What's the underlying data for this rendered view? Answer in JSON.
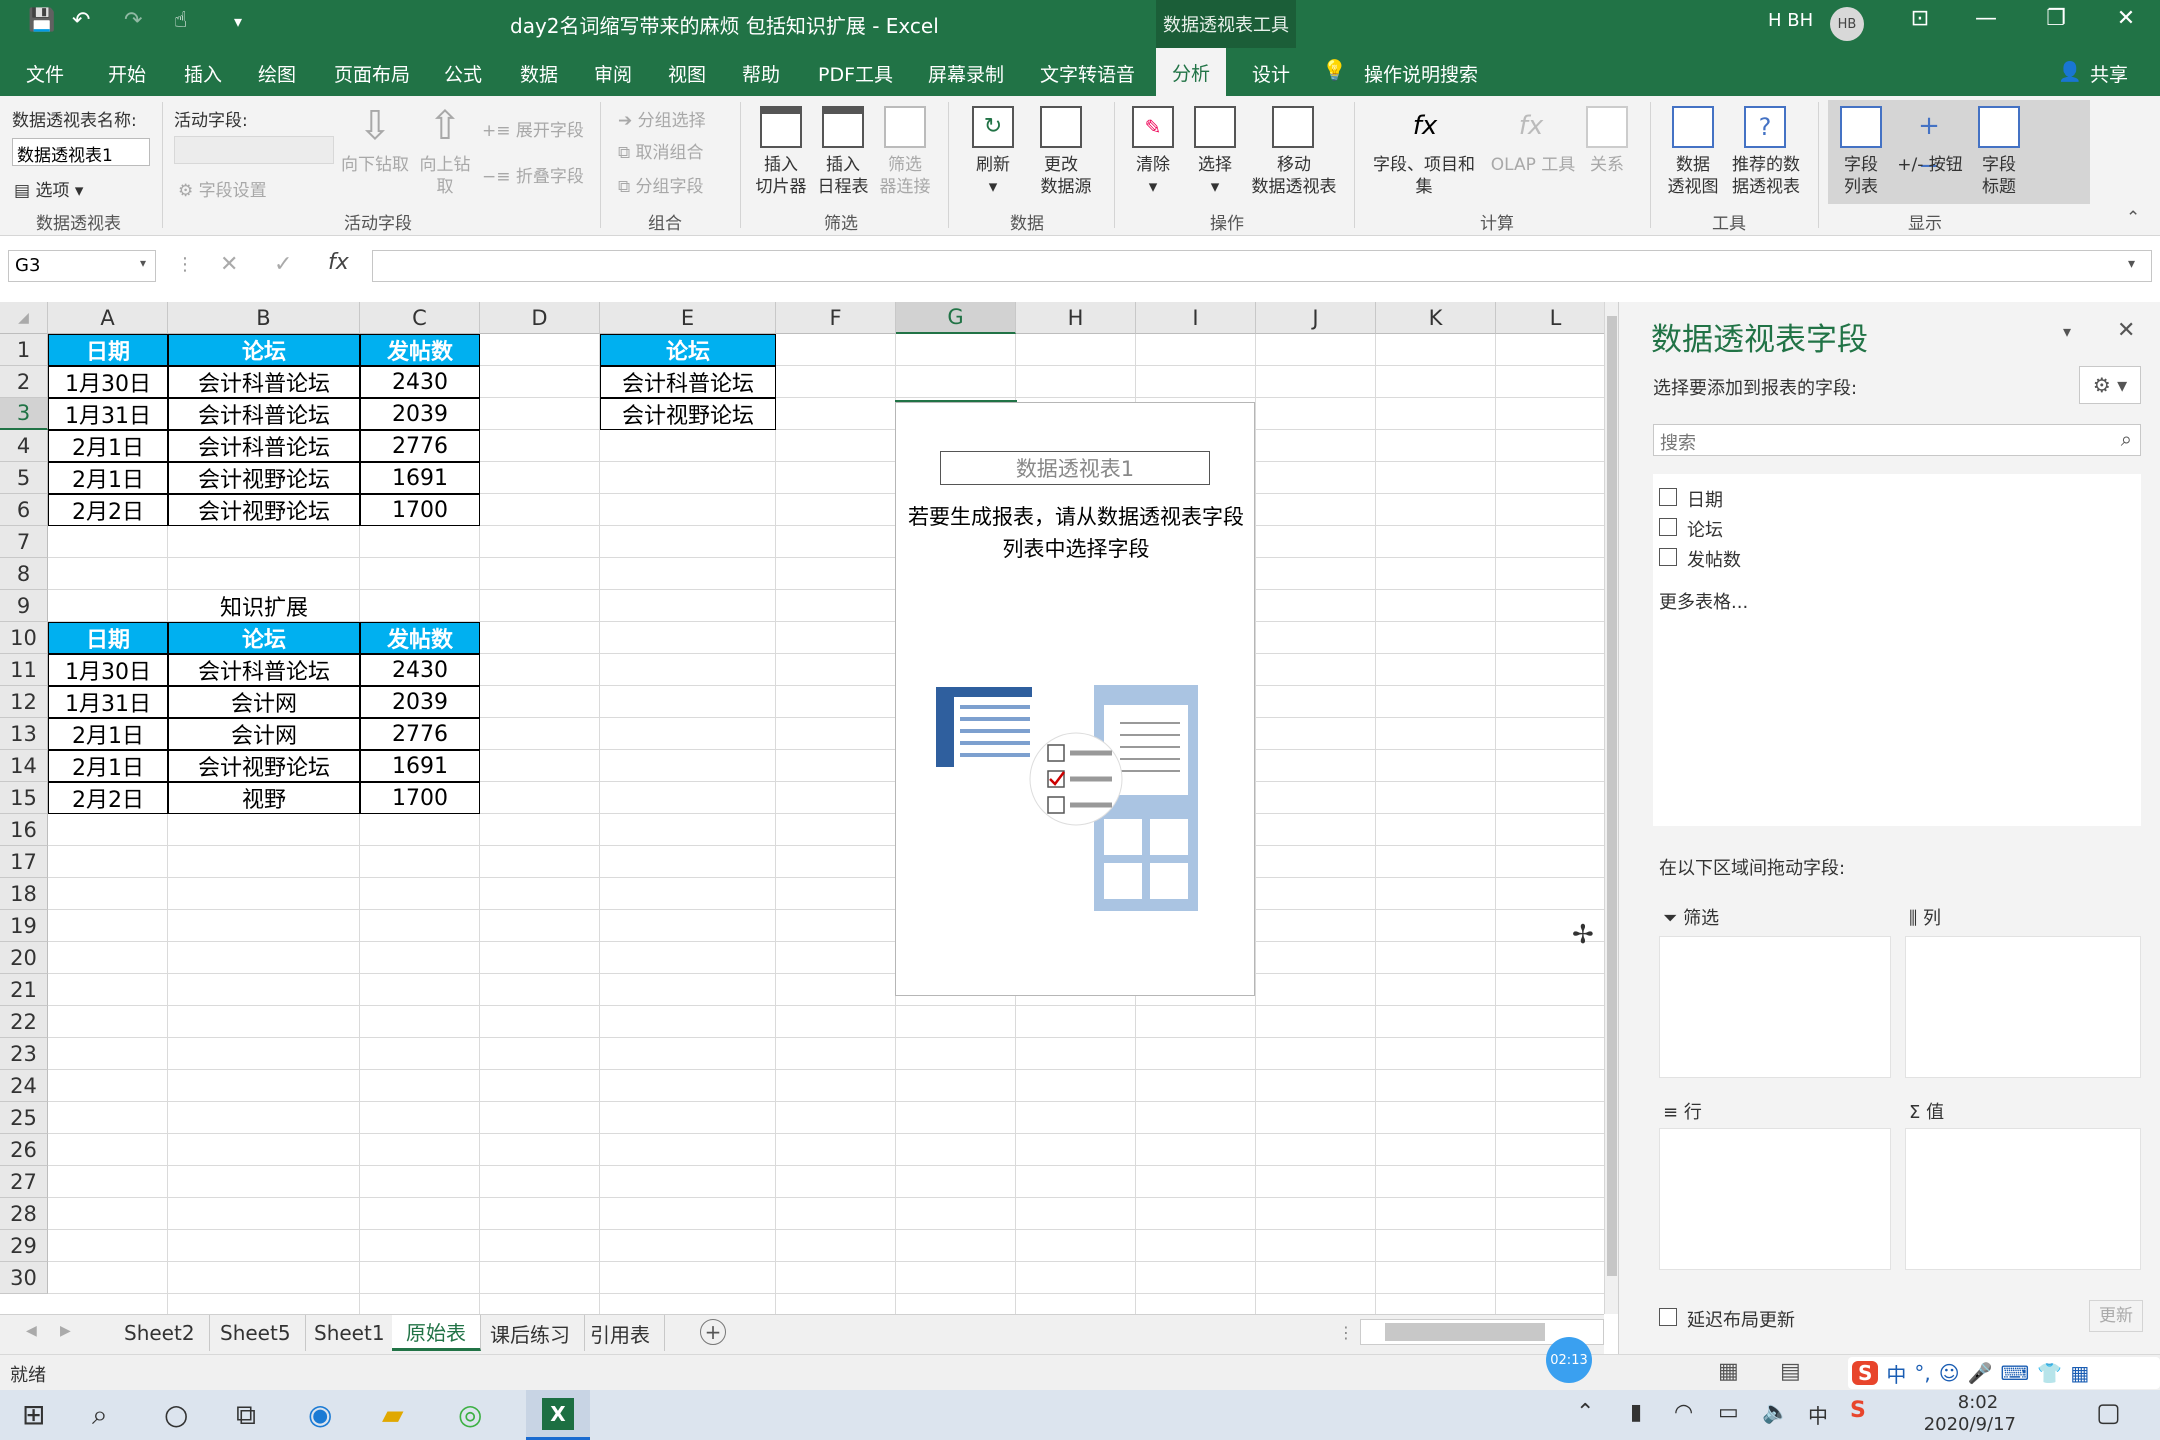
{
  "title_bar": {
    "title": "day2名词缩写带来的麻烦 包括知识扩展 - Excel",
    "context_tab": "数据透视表工具",
    "user": "H BH",
    "avatar_initials": "HB"
  },
  "menu": {
    "tabs": [
      "文件",
      "开始",
      "插入",
      "绘图",
      "页面布局",
      "公式",
      "数据",
      "审阅",
      "视图",
      "帮助",
      "PDF工具",
      "屏幕录制",
      "文字转语音",
      "分析",
      "设计"
    ],
    "active": "分析",
    "tell_me": "操作说明搜索",
    "share": "共享"
  },
  "ribbon": {
    "pivot_group": {
      "name_label": "数据透视表名称:",
      "name_value": "数据透视表1",
      "options": "选项",
      "group": "数据透视表"
    },
    "active_field": {
      "label": "活动字段:",
      "field_settings": "字段设置",
      "drill_down": "向下钻取",
      "drill_up": "向上钻",
      "drill_up2": "取",
      "expand": "展开字段",
      "collapse": "折叠字段",
      "group": "活动字段"
    },
    "group_group": {
      "group_sel": "分组选择",
      "ungroup": "取消组合",
      "group_field": "分组字段",
      "group": "组合"
    },
    "filter": {
      "slicer1": "插入",
      "slicer2": "切片器",
      "timeline1": "插入",
      "timeline2": "日程表",
      "conn1": "筛选",
      "conn2": "器连接",
      "group": "筛选"
    },
    "data": {
      "refresh": "刷新",
      "change1": "更改",
      "change2": "数据源",
      "group": "数据"
    },
    "actions": {
      "clear": "清除",
      "select": "选择",
      "move1": "移动",
      "move2": "数据透视表",
      "group": "操作"
    },
    "calc": {
      "fields1": "字段、项目和",
      "fields2": "集",
      "olap": "OLAP 工具",
      "rel": "关系",
      "group": "计算"
    },
    "tools": {
      "chart1": "数据",
      "chart2": "透视图",
      "rec1": "推荐的数",
      "rec2": "据透视表",
      "group": "工具"
    },
    "show": {
      "list1": "字段",
      "list2": "列表",
      "btn": "+/- 按钮",
      "hdr1": "字段",
      "hdr2": "标题",
      "group": "显示"
    }
  },
  "formula_bar": {
    "name_box": "G3",
    "formula": ""
  },
  "grid": {
    "columns": [
      "A",
      "B",
      "C",
      "D",
      "E",
      "F",
      "G",
      "H",
      "I",
      "J",
      "K",
      "L"
    ],
    "rows": [
      "1",
      "2",
      "3",
      "4",
      "5",
      "6",
      "7",
      "8",
      "9",
      "10",
      "11",
      "12",
      "13",
      "14",
      "15",
      "16",
      "17",
      "18",
      "19",
      "20",
      "21",
      "22",
      "23",
      "24",
      "25",
      "26",
      "27",
      "28",
      "29",
      "30"
    ],
    "table1": {
      "headers": [
        "日期",
        "论坛",
        "发帖数"
      ],
      "rows": [
        [
          "1月30日",
          "会计科普论坛",
          "2430"
        ],
        [
          "1月31日",
          "会计科普论坛",
          "2039"
        ],
        [
          "2月1日",
          "会计科普论坛",
          "2776"
        ],
        [
          "2月1日",
          "会计视野论坛",
          "1691"
        ],
        [
          "2月2日",
          "会计视野论坛",
          "1700"
        ]
      ]
    },
    "table_e": {
      "header": "论坛",
      "rows": [
        "会计科普论坛",
        "会计视野论坛"
      ]
    },
    "section_title": "知识扩展",
    "table2": {
      "headers": [
        "日期",
        "论坛",
        "发帖数"
      ],
      "rows": [
        [
          "1月30日",
          "会计科普论坛",
          "2430"
        ],
        [
          "1月31日",
          "会计网",
          "2039"
        ],
        [
          "2月1日",
          "会计网",
          "2776"
        ],
        [
          "2月1日",
          "会计视野论坛",
          "1691"
        ],
        [
          "2月2日",
          "视野",
          "1700"
        ]
      ]
    },
    "pivot_placeholder": {
      "title": "数据透视表1",
      "hint1": "若要生成报表，请从数据透视表字段",
      "hint2": "列表中选择字段"
    }
  },
  "sheet_tabs": {
    "tabs": [
      "Sheet2",
      "Sheet5",
      "Sheet1",
      "原始表",
      "课后练习",
      "引用表"
    ],
    "active": "原始表"
  },
  "status": {
    "ready": "就绪",
    "timer": "02:13"
  },
  "taskbar": {
    "time": "8:02",
    "date": "2020/9/17",
    "ime": "中"
  },
  "field_pane": {
    "title": "数据透视表字段",
    "choose": "选择要添加到报表的字段:",
    "search_placeholder": "搜索",
    "fields": [
      "日期",
      "论坛",
      "发帖数"
    ],
    "more": "更多表格...",
    "drag": "在以下区域间拖动字段:",
    "filter": "筛选",
    "columns": "列",
    "rows": "行",
    "values": "值",
    "defer": "延迟布局更新",
    "update": "更新"
  },
  "colors": {
    "excel_green": "#217346",
    "header_blue": "#00b0f0"
  }
}
